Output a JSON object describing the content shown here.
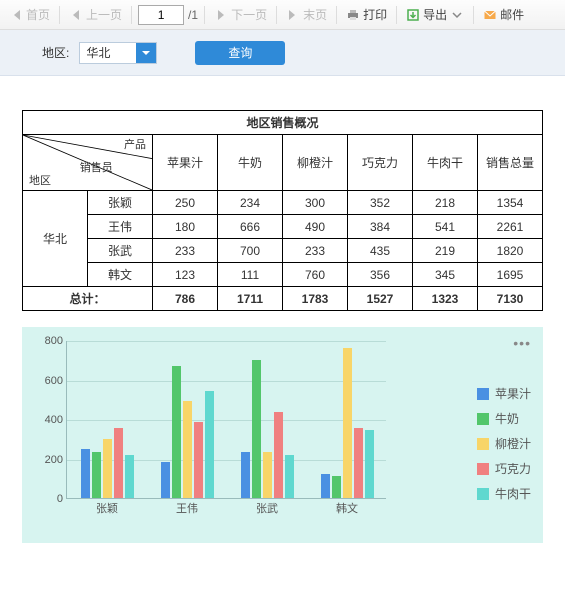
{
  "toolbar": {
    "first": "首页",
    "prev": "上一页",
    "page": "1",
    "totalPrefix": "/",
    "total": "1",
    "next": "下一页",
    "last": "末页",
    "print": "打印",
    "export": "导出",
    "mail": "邮件"
  },
  "params": {
    "region_label": "地区:",
    "region_value": "华北",
    "query_btn": "查询"
  },
  "report": {
    "title": "地区销售概况",
    "diag": {
      "product": "产品",
      "salesman": "销售员",
      "region": "地区"
    },
    "columns": [
      "苹果汁",
      "牛奶",
      "柳橙汁",
      "巧克力",
      "牛肉干"
    ],
    "total_col": "销售总量",
    "region": "华北",
    "rows": [
      {
        "name": "张颖",
        "v": [
          250,
          234,
          300,
          352,
          218
        ],
        "sum": 1354
      },
      {
        "name": "王伟",
        "v": [
          180,
          666,
          490,
          384,
          541
        ],
        "sum": 2261
      },
      {
        "name": "张武",
        "v": [
          233,
          700,
          233,
          435,
          219
        ],
        "sum": 1820
      },
      {
        "name": "韩文",
        "v": [
          123,
          111,
          760,
          356,
          345
        ],
        "sum": 1695
      }
    ],
    "total_label": "总计：",
    "totals": [
      786,
      1711,
      1783,
      1527,
      1323,
      7130
    ]
  },
  "chart_data": {
    "type": "bar",
    "categories": [
      "张颖",
      "王伟",
      "张武",
      "韩文"
    ],
    "series": [
      {
        "name": "苹果汁",
        "color": "#4a90e2",
        "values": [
          250,
          180,
          233,
          123
        ]
      },
      {
        "name": "牛奶",
        "color": "#52c66b",
        "values": [
          234,
          666,
          700,
          111
        ]
      },
      {
        "name": "柳橙汁",
        "color": "#f8d568",
        "values": [
          300,
          490,
          233,
          760
        ]
      },
      {
        "name": "巧克力",
        "color": "#f08080",
        "values": [
          352,
          384,
          435,
          356
        ]
      },
      {
        "name": "牛肉干",
        "color": "#5fd8cf",
        "values": [
          218,
          541,
          219,
          345
        ]
      }
    ],
    "ylim": [
      0,
      800
    ],
    "yticks": [
      0,
      200,
      400,
      600,
      800
    ],
    "title": "",
    "xlabel": "",
    "ylabel": ""
  }
}
